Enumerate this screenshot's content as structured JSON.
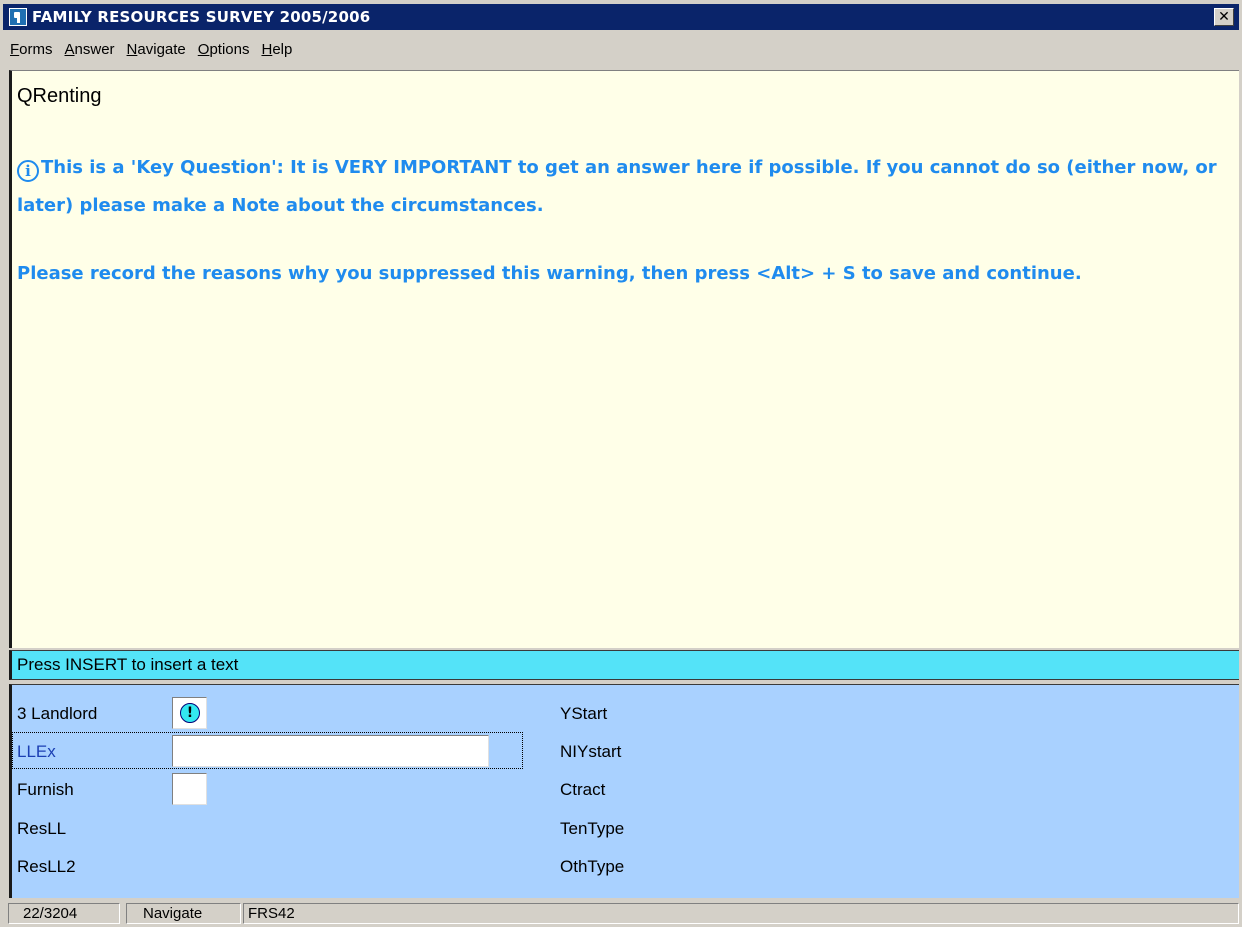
{
  "window": {
    "title": "FAMILY RESOURCES SURVEY 2005/2006",
    "close_glyph": "✕"
  },
  "menu": {
    "items": [
      {
        "first": "F",
        "rest": "orms"
      },
      {
        "first": "A",
        "rest": "nswer"
      },
      {
        "first": "N",
        "rest": "avigate"
      },
      {
        "first": "O",
        "rest": "ptions"
      },
      {
        "first": "H",
        "rest": "elp"
      }
    ]
  },
  "question": {
    "name": "QRenting",
    "info_glyph": "i",
    "line1": "This is a 'Key Question': It is VERY IMPORTANT to get an answer here if possible. If you cannot do so (either now, or later) please make a Note about the circumstances.",
    "line2": "Please record the reasons why you suppressed this warning, then press <Alt> + S to save and continue."
  },
  "status_line": "Press INSERT to insert a text",
  "form": {
    "left_fields": [
      {
        "label": "3 Landlord"
      },
      {
        "label": "LLEx"
      },
      {
        "label": "Furnish"
      },
      {
        "label": "ResLL"
      },
      {
        "label": "ResLL2"
      }
    ],
    "right_fields": [
      "YStart",
      "NIYstart",
      "Ctract",
      "TenType",
      "OthType"
    ],
    "warn_glyph": "!",
    "llex_value": "",
    "furnish_value": ""
  },
  "statusbar": {
    "position": "22/3204",
    "mode": "Navigate",
    "form_id": "FRS42"
  },
  "colors": {
    "title_bar": "#0a246a",
    "question_bg": "#ffffe8",
    "question_text": "#1f8bee",
    "status_line_bg": "#54e3f8",
    "form_bg": "#a9d1ff"
  }
}
